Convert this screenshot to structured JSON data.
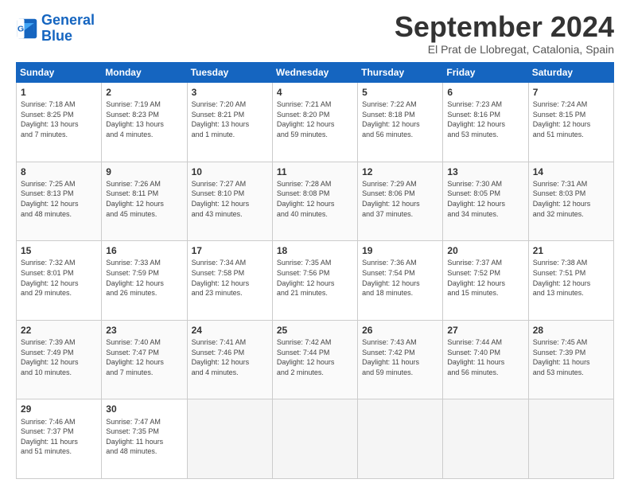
{
  "logo": {
    "line1": "General",
    "line2": "Blue"
  },
  "title": "September 2024",
  "subtitle": "El Prat de Llobregat, Catalonia, Spain",
  "headers": [
    "Sunday",
    "Monday",
    "Tuesday",
    "Wednesday",
    "Thursday",
    "Friday",
    "Saturday"
  ],
  "weeks": [
    [
      {
        "num": "1",
        "info": "Sunrise: 7:18 AM\nSunset: 8:25 PM\nDaylight: 13 hours\nand 7 minutes."
      },
      {
        "num": "2",
        "info": "Sunrise: 7:19 AM\nSunset: 8:23 PM\nDaylight: 13 hours\nand 4 minutes."
      },
      {
        "num": "3",
        "info": "Sunrise: 7:20 AM\nSunset: 8:21 PM\nDaylight: 13 hours\nand 1 minute."
      },
      {
        "num": "4",
        "info": "Sunrise: 7:21 AM\nSunset: 8:20 PM\nDaylight: 12 hours\nand 59 minutes."
      },
      {
        "num": "5",
        "info": "Sunrise: 7:22 AM\nSunset: 8:18 PM\nDaylight: 12 hours\nand 56 minutes."
      },
      {
        "num": "6",
        "info": "Sunrise: 7:23 AM\nSunset: 8:16 PM\nDaylight: 12 hours\nand 53 minutes."
      },
      {
        "num": "7",
        "info": "Sunrise: 7:24 AM\nSunset: 8:15 PM\nDaylight: 12 hours\nand 51 minutes."
      }
    ],
    [
      {
        "num": "8",
        "info": "Sunrise: 7:25 AM\nSunset: 8:13 PM\nDaylight: 12 hours\nand 48 minutes."
      },
      {
        "num": "9",
        "info": "Sunrise: 7:26 AM\nSunset: 8:11 PM\nDaylight: 12 hours\nand 45 minutes."
      },
      {
        "num": "10",
        "info": "Sunrise: 7:27 AM\nSunset: 8:10 PM\nDaylight: 12 hours\nand 43 minutes."
      },
      {
        "num": "11",
        "info": "Sunrise: 7:28 AM\nSunset: 8:08 PM\nDaylight: 12 hours\nand 40 minutes."
      },
      {
        "num": "12",
        "info": "Sunrise: 7:29 AM\nSunset: 8:06 PM\nDaylight: 12 hours\nand 37 minutes."
      },
      {
        "num": "13",
        "info": "Sunrise: 7:30 AM\nSunset: 8:05 PM\nDaylight: 12 hours\nand 34 minutes."
      },
      {
        "num": "14",
        "info": "Sunrise: 7:31 AM\nSunset: 8:03 PM\nDaylight: 12 hours\nand 32 minutes."
      }
    ],
    [
      {
        "num": "15",
        "info": "Sunrise: 7:32 AM\nSunset: 8:01 PM\nDaylight: 12 hours\nand 29 minutes."
      },
      {
        "num": "16",
        "info": "Sunrise: 7:33 AM\nSunset: 7:59 PM\nDaylight: 12 hours\nand 26 minutes."
      },
      {
        "num": "17",
        "info": "Sunrise: 7:34 AM\nSunset: 7:58 PM\nDaylight: 12 hours\nand 23 minutes."
      },
      {
        "num": "18",
        "info": "Sunrise: 7:35 AM\nSunset: 7:56 PM\nDaylight: 12 hours\nand 21 minutes."
      },
      {
        "num": "19",
        "info": "Sunrise: 7:36 AM\nSunset: 7:54 PM\nDaylight: 12 hours\nand 18 minutes."
      },
      {
        "num": "20",
        "info": "Sunrise: 7:37 AM\nSunset: 7:52 PM\nDaylight: 12 hours\nand 15 minutes."
      },
      {
        "num": "21",
        "info": "Sunrise: 7:38 AM\nSunset: 7:51 PM\nDaylight: 12 hours\nand 13 minutes."
      }
    ],
    [
      {
        "num": "22",
        "info": "Sunrise: 7:39 AM\nSunset: 7:49 PM\nDaylight: 12 hours\nand 10 minutes."
      },
      {
        "num": "23",
        "info": "Sunrise: 7:40 AM\nSunset: 7:47 PM\nDaylight: 12 hours\nand 7 minutes."
      },
      {
        "num": "24",
        "info": "Sunrise: 7:41 AM\nSunset: 7:46 PM\nDaylight: 12 hours\nand 4 minutes."
      },
      {
        "num": "25",
        "info": "Sunrise: 7:42 AM\nSunset: 7:44 PM\nDaylight: 12 hours\nand 2 minutes."
      },
      {
        "num": "26",
        "info": "Sunrise: 7:43 AM\nSunset: 7:42 PM\nDaylight: 11 hours\nand 59 minutes."
      },
      {
        "num": "27",
        "info": "Sunrise: 7:44 AM\nSunset: 7:40 PM\nDaylight: 11 hours\nand 56 minutes."
      },
      {
        "num": "28",
        "info": "Sunrise: 7:45 AM\nSunset: 7:39 PM\nDaylight: 11 hours\nand 53 minutes."
      }
    ],
    [
      {
        "num": "29",
        "info": "Sunrise: 7:46 AM\nSunset: 7:37 PM\nDaylight: 11 hours\nand 51 minutes."
      },
      {
        "num": "30",
        "info": "Sunrise: 7:47 AM\nSunset: 7:35 PM\nDaylight: 11 hours\nand 48 minutes."
      },
      null,
      null,
      null,
      null,
      null
    ]
  ]
}
